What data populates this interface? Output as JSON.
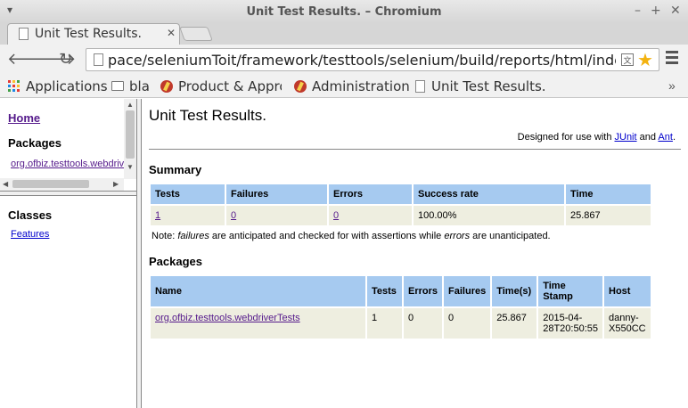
{
  "window": {
    "title": "Unit Test Results. – Chromium",
    "menu_glyph": "▾",
    "minimize": "–",
    "maximize": "+",
    "close": "✕"
  },
  "tab": {
    "title": "Unit Test Results.",
    "close": "✕"
  },
  "toolbar": {
    "back": "🡐",
    "forward": "🡒",
    "reload": "↻",
    "url": "pace/seleniumToit/framework/testtools/selenium/build/reports/html/index.html",
    "translate_glyph": "文",
    "star_glyph": "★"
  },
  "bookmarks": {
    "items": [
      "Applications",
      "bla",
      "Product & Appro",
      "Administration",
      "Unit Test Results."
    ],
    "more": "»",
    "apps_colors": [
      "#e53935",
      "#fbc02d",
      "#43a047",
      "#1e88e5",
      "#e53935",
      "#fbc02d",
      "#43a047",
      "#1e88e5",
      "#e53935"
    ]
  },
  "left_top": {
    "home": "Home",
    "packages_heading": "Packages",
    "package_link": "org.ofbiz.testtools.webdriverTests"
  },
  "left_bottom": {
    "classes_heading": "Classes",
    "class_link": "Features"
  },
  "main": {
    "title": "Unit Test Results.",
    "designed_prefix": "Designed for use with ",
    "junit": "JUnit",
    "and": " and ",
    "ant": "Ant",
    "period": ".",
    "summary_heading": "Summary",
    "summary_headers": [
      "Tests",
      "Failures",
      "Errors",
      "Success rate",
      "Time"
    ],
    "summary_row": [
      "1",
      "0",
      "0",
      "100.00%",
      "25.867"
    ],
    "note_prefix": "Note: ",
    "note_failures": "failures",
    "note_middle": " are anticipated and checked for with assertions while ",
    "note_errors": "errors",
    "note_suffix": " are unanticipated.",
    "packages_heading": "Packages",
    "packages_headers": [
      "Name",
      "Tests",
      "Errors",
      "Failures",
      "Time(s)",
      "Time Stamp",
      "Host"
    ],
    "packages_row": {
      "name": "org.ofbiz.testtools.webdriverTests",
      "tests": "1",
      "errors": "0",
      "failures": "0",
      "time": "25.867",
      "timestamp_line1": "2015-04-",
      "timestamp_line2": "28T20:50:55",
      "host_line1": "danny-",
      "host_line2": "X550CC"
    }
  }
}
